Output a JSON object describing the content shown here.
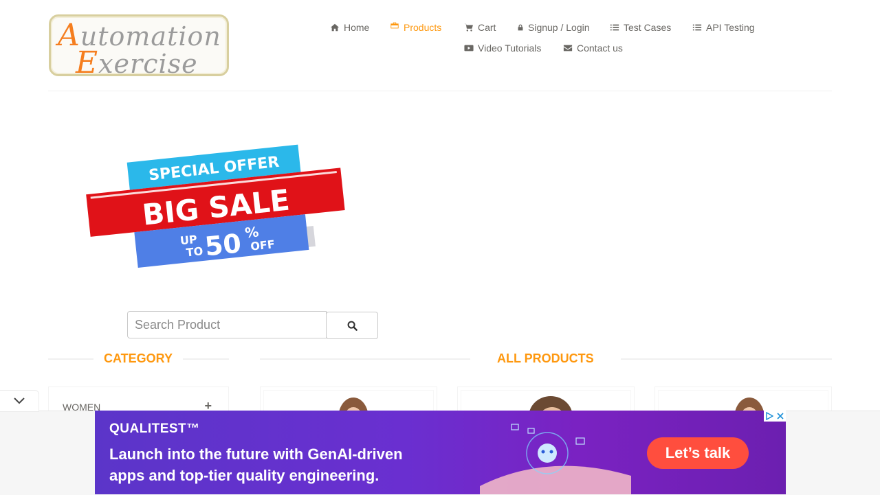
{
  "header": {
    "logo": {
      "line1_cap": "A",
      "line1_rest": "utomation",
      "line2_cap": "E",
      "line2_rest": "xercise"
    },
    "nav": [
      {
        "label": "Home",
        "icon": "home-icon"
      },
      {
        "label": "Products",
        "icon": "briefcase-icon",
        "active": true
      },
      {
        "label": "Cart",
        "icon": "cart-icon"
      },
      {
        "label": "Signup / Login",
        "icon": "lock-icon"
      },
      {
        "label": "Test Cases",
        "icon": "list-icon"
      },
      {
        "label": "API Testing",
        "icon": "list-icon"
      },
      {
        "label": "Video Tutorials",
        "icon": "youtube-play-icon"
      },
      {
        "label": "Contact us",
        "icon": "envelope-icon"
      }
    ]
  },
  "banner": {
    "line1": "SPECIAL OFFER",
    "line2": "BIG SALE",
    "up": "UP",
    "to": "TO",
    "percent": "50",
    "percent_sign": "%",
    "off": "OFF"
  },
  "search": {
    "placeholder": "Search Product",
    "button_icon": "search-icon"
  },
  "sidebar": {
    "title": "Category",
    "items": [
      {
        "label": "WOMEN",
        "toggle": "+"
      }
    ]
  },
  "main": {
    "title": "All Products"
  },
  "ad": {
    "brand": "QUALITEST™",
    "copy": "Launch into the future with GenAI-driven apps and top-tier quality engineering.",
    "cta": "Let’s talk"
  },
  "colors": {
    "accent": "#FE980F",
    "text": "#696763",
    "ad_cta": "#ff4e3e",
    "ad_bg": "#6a2fd0"
  }
}
